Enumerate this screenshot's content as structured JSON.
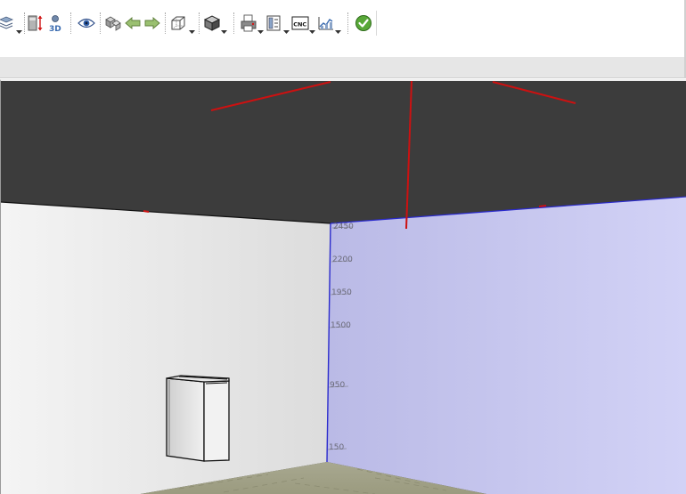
{
  "toolbar": {
    "buttons": [
      {
        "name": "layers-icon",
        "has_dropdown": true
      },
      {
        "name": "height-dimension-icon",
        "has_dropdown": false
      },
      {
        "name": "view-3d-icon",
        "label": "3D",
        "has_dropdown": false
      },
      {
        "name": "visibility-eye-icon",
        "has_dropdown": false
      },
      {
        "name": "copy-objects-icon",
        "has_dropdown": false
      },
      {
        "name": "arrow-left-icon",
        "has_dropdown": false
      },
      {
        "name": "arrow-right-icon",
        "has_dropdown": false
      },
      {
        "name": "wireframe-box-icon",
        "has_dropdown": true
      },
      {
        "name": "solid-box-icon",
        "has_dropdown": true
      },
      {
        "name": "print-icon",
        "has_dropdown": true
      },
      {
        "name": "panel-layout-icon",
        "has_dropdown": true
      },
      {
        "name": "cnc-export-icon",
        "label": "CNC",
        "has_dropdown": true
      },
      {
        "name": "chart-report-icon",
        "has_dropdown": true
      },
      {
        "name": "check-ok-icon",
        "has_dropdown": false
      }
    ]
  },
  "viewport": {
    "scale_labels": [
      "2450",
      "2200",
      "1950",
      "1500",
      "950",
      "150"
    ],
    "colors": {
      "ceiling": "#3c3c3c",
      "left_wall": "#eeeeee",
      "right_wall": "#c8c8f0",
      "floor": "#a6a68a",
      "axis_red": "#cc1111",
      "corner_blue": "#2a2acc"
    }
  }
}
